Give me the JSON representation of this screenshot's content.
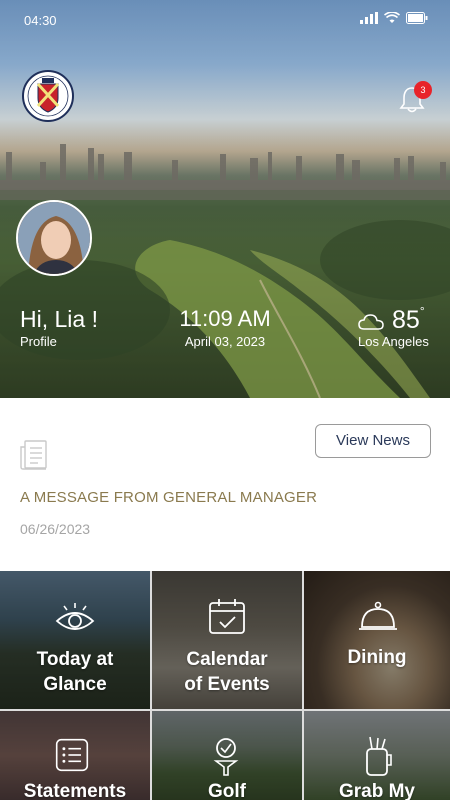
{
  "status_bar": {
    "time": "04:30"
  },
  "header": {
    "notification_count": "3"
  },
  "profile": {
    "greeting": "Hi, Lia !",
    "link_label": "Profile"
  },
  "clock": {
    "time": "11:09 AM",
    "date": "April 03, 2023"
  },
  "weather": {
    "temperature": "85",
    "unit_mark": "°",
    "city": "Los Angeles"
  },
  "news": {
    "button_label": "View News",
    "title": "A MESSAGE FROM GENERAL MANAGER",
    "date": "06/26/2023"
  },
  "tiles": [
    {
      "label": "Today at Glance",
      "icon": "eye-icon"
    },
    {
      "label": "Calendar of Events",
      "icon": "calendar-icon"
    },
    {
      "label": "Dining",
      "icon": "cloche-icon"
    },
    {
      "label": "Statements",
      "icon": "list-icon"
    },
    {
      "label": "Golf",
      "icon": "golf-tee-icon"
    },
    {
      "label": "Grab My",
      "icon": "golf-bag-icon"
    }
  ],
  "colors": {
    "news_title": "#8a7a4e",
    "news_date": "#a5a5a5",
    "badge": "#e8232a",
    "button_text": "#2b3a5a"
  }
}
